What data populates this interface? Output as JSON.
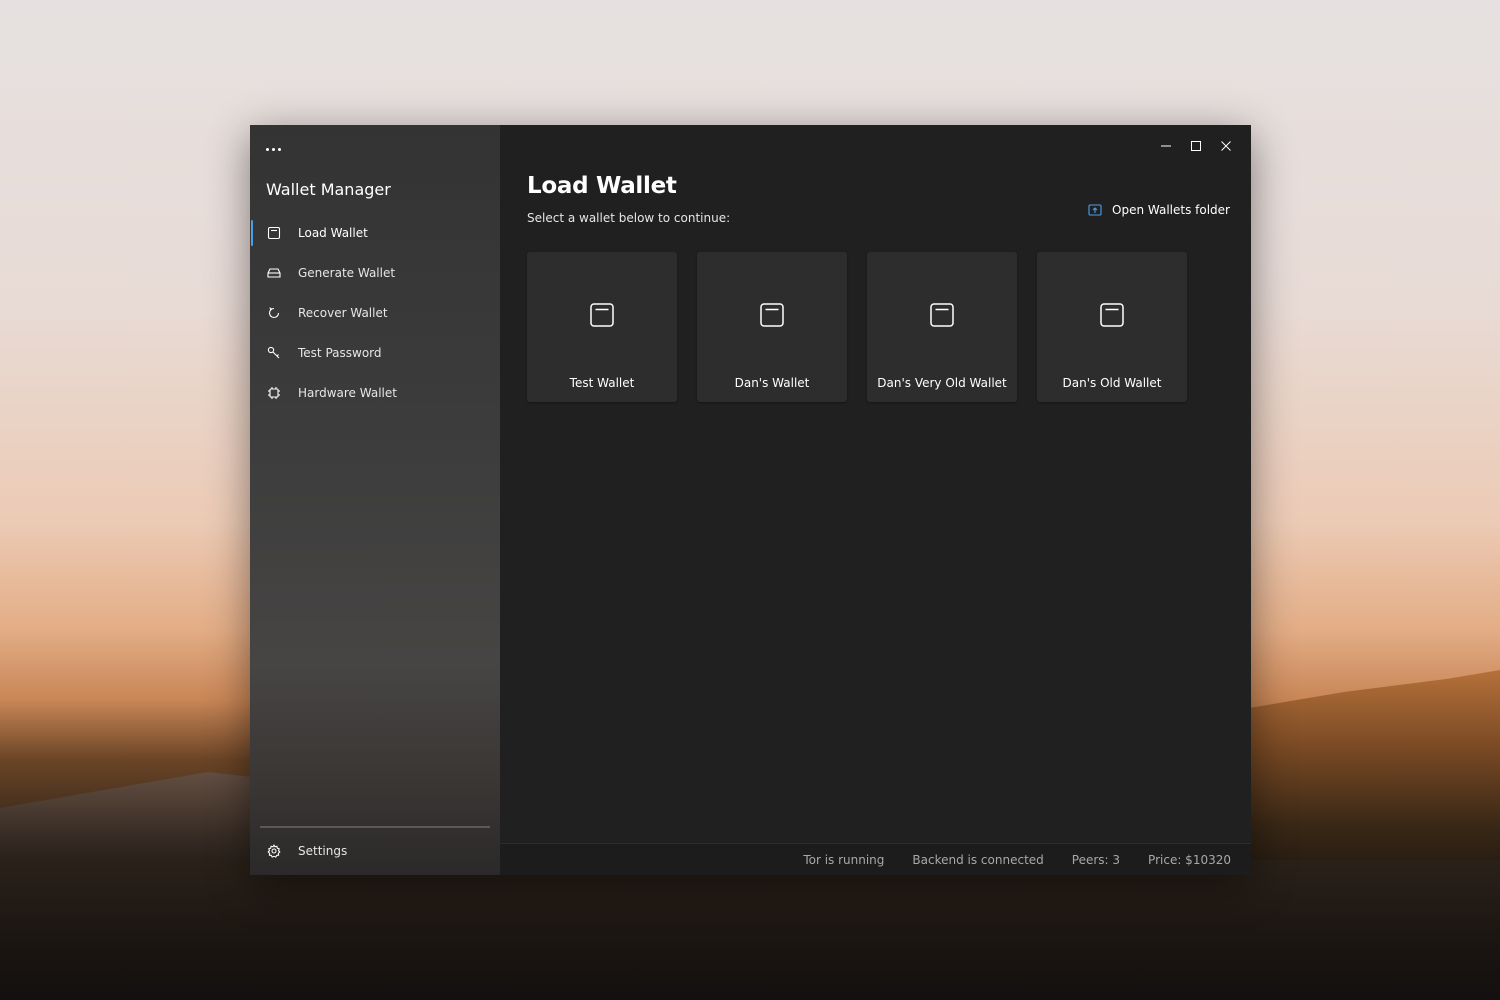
{
  "sidebar": {
    "title": "Wallet Manager",
    "items": [
      {
        "label": "Load Wallet",
        "icon": "wallet-icon",
        "active": true
      },
      {
        "label": "Generate Wallet",
        "icon": "inbox-icon",
        "active": false
      },
      {
        "label": "Recover Wallet",
        "icon": "refresh-icon",
        "active": false
      },
      {
        "label": "Test Password",
        "icon": "key-icon",
        "active": false
      },
      {
        "label": "Hardware Wallet",
        "icon": "chip-icon",
        "active": false
      }
    ],
    "settings_label": "Settings",
    "accent": "#4aa0e6"
  },
  "main": {
    "title": "Load Wallet",
    "subtitle": "Select a wallet below to continue:",
    "open_folder_label": "Open Wallets folder",
    "wallets": [
      {
        "label": "Test Wallet"
      },
      {
        "label": "Dan's Wallet"
      },
      {
        "label": "Dan's Very Old Wallet"
      },
      {
        "label": "Dan's Old Wallet"
      }
    ]
  },
  "status": {
    "tor": "Tor is running",
    "backend": "Backend is connected",
    "peers": "Peers: 3",
    "price": "Price: $10320"
  }
}
